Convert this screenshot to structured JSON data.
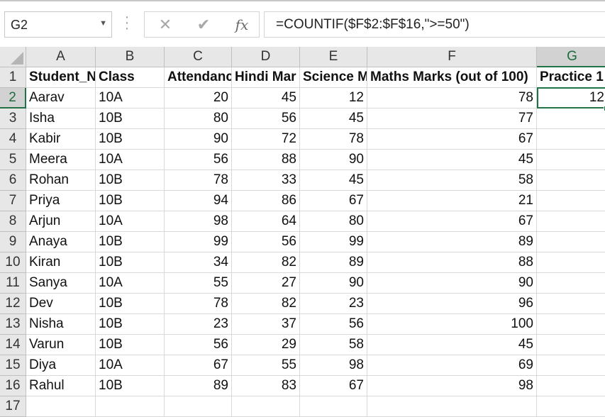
{
  "name_box": {
    "value": "G2"
  },
  "formula_bar": {
    "cancel_icon": "x-icon",
    "enter_icon": "check-icon",
    "function_label": "fx",
    "formula": "=COUNTIF($F$2:$F$16,\">=50\")"
  },
  "columns": [
    "A",
    "B",
    "C",
    "D",
    "E",
    "F",
    "G"
  ],
  "selected_column": "G",
  "row_numbers": [
    "1",
    "2",
    "3",
    "4",
    "5",
    "6",
    "7",
    "8",
    "9",
    "10",
    "11",
    "12",
    "13",
    "14",
    "15",
    "16",
    "17"
  ],
  "selected_row": "2",
  "headers": [
    "Student_N",
    "Class",
    "Attendanc",
    "Hindi Mar",
    "Science M",
    "Maths Marks (out of 100)",
    "Practice 1"
  ],
  "rows": [
    [
      "Aarav",
      "10A",
      "20",
      "45",
      "12",
      "78",
      "12"
    ],
    [
      "Isha",
      "10B",
      "80",
      "56",
      "45",
      "77",
      ""
    ],
    [
      "Kabir",
      "10B",
      "90",
      "72",
      "78",
      "67",
      ""
    ],
    [
      "Meera",
      "10A",
      "56",
      "88",
      "90",
      "45",
      ""
    ],
    [
      "Rohan",
      "10B",
      "78",
      "33",
      "45",
      "58",
      ""
    ],
    [
      "Priya",
      "10B",
      "94",
      "86",
      "67",
      "21",
      ""
    ],
    [
      "Arjun",
      "10A",
      "98",
      "64",
      "80",
      "67",
      ""
    ],
    [
      "Anaya",
      "10B",
      "99",
      "56",
      "99",
      "89",
      ""
    ],
    [
      "Kiran",
      "10B",
      "34",
      "82",
      "89",
      "88",
      ""
    ],
    [
      "Sanya",
      "10A",
      "55",
      "27",
      "90",
      "90",
      ""
    ],
    [
      "Dev",
      "10B",
      "78",
      "82",
      "23",
      "96",
      ""
    ],
    [
      "Nisha",
      "10B",
      "23",
      "37",
      "56",
      "100",
      ""
    ],
    [
      "Varun",
      "10B",
      "56",
      "29",
      "58",
      "45",
      ""
    ],
    [
      "Diya",
      "10A",
      "67",
      "55",
      "98",
      "69",
      ""
    ],
    [
      "Rahul",
      "10B",
      "89",
      "83",
      "67",
      "98",
      ""
    ]
  ],
  "colors": {
    "accent": "#217346",
    "header_bg": "#e7e7e7",
    "gridline": "#d9d9d9"
  }
}
